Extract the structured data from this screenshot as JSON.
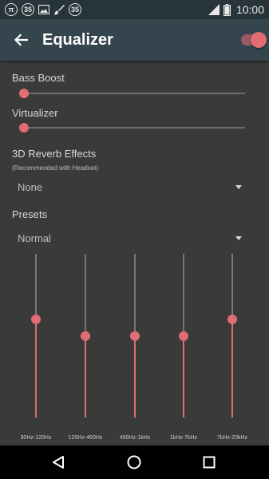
{
  "status_bar": {
    "time": "10:00",
    "badge_pi": "π",
    "badge_35a": "35",
    "badge_35b": "35",
    "icons": [
      "pi-icon",
      "badge-35-icon",
      "image-icon",
      "brush-icon",
      "badge-35-icon",
      "signal-icon",
      "battery-icon"
    ]
  },
  "app_bar": {
    "title": "Equalizer",
    "toggle_on": true
  },
  "bass_boost": {
    "label": "Bass Boost",
    "level": 0
  },
  "virtualizer": {
    "label": "Virtualizer",
    "level": 0
  },
  "reverb": {
    "label": "3D Reverb Effects",
    "note": "(Recommended with Headset)",
    "value": "None"
  },
  "presets": {
    "label": "Presets",
    "value": "Normal"
  },
  "equalizer": {
    "bands": [
      {
        "label": "30Hz-120Hz",
        "level": 0.6
      },
      {
        "label": "120Hz-460Hz",
        "level": 0.5
      },
      {
        "label": "460Hz-1kHz",
        "level": 0.5
      },
      {
        "label": "1kHz-7kHz",
        "level": 0.5
      },
      {
        "label": "7kHz-20kHz",
        "level": 0.6
      }
    ]
  },
  "colors": {
    "accent": "#e06c75",
    "app_bar": "#35454d",
    "status_bar": "#27343a",
    "background": "#3a3a3a"
  }
}
